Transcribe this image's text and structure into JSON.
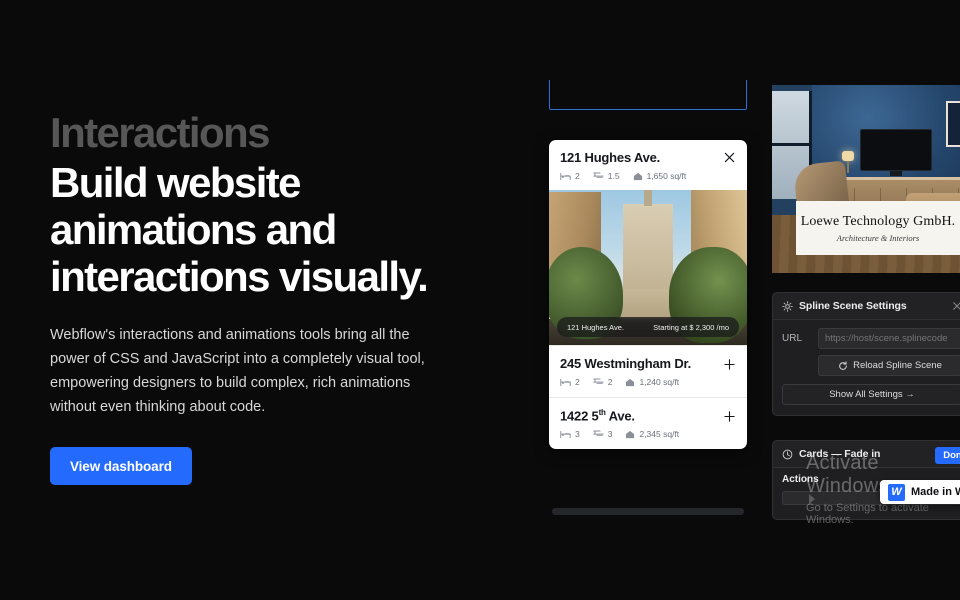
{
  "hero": {
    "eyebrow": "Interactions",
    "title_line1": "Build website",
    "title_line2": "animations and",
    "title_line3": "interactions visually.",
    "body": "Webflow's interactions and animations tools bring all the power of CSS and JavaScript into a completely visual tool, empowering designers to build complex, rich animations without even thinking about code.",
    "cta_label": "View dashboard",
    "accent_color": "#246bfd",
    "eyebrow_color": "#575757"
  },
  "property_card": {
    "header": {
      "title": "121 Hughes Ave.",
      "close_icon": "close-icon",
      "beds": "2",
      "baths": "1.5",
      "area": "1,650 sq/ft"
    },
    "photo_overlay": {
      "address": "121 Hughes Ave.",
      "price": "Starting at $ 2,300 /mo"
    },
    "listings": [
      {
        "title": "245 Westmingham Dr.",
        "beds": "2",
        "baths": "2",
        "area": "1,240 sq/ft",
        "action_icon": "plus-icon"
      },
      {
        "title": "1422 5",
        "title_sup": "th",
        "title_rest": " Ave.",
        "beds": "3",
        "baths": "3",
        "area": "2,345 sq/ft",
        "action_icon": "plus-icon"
      }
    ]
  },
  "showcase": {
    "plate_name": "Loewe Technology GmbH.",
    "plate_subtitle": "Architecture & Interiors"
  },
  "spline_panel": {
    "title": "Spline Scene Settings",
    "icon": "gear-icon",
    "close_icon": "close-icon",
    "url_label": "URL",
    "url_value": "https://host/scene.splinecode",
    "reload_label": "Reload Spline Scene",
    "reload_icon": "refresh-icon",
    "show_all_label": "Show All Settings  →"
  },
  "cards_panel": {
    "title": "Cards — Fade in",
    "icon": "clock-icon",
    "done_label": "Done",
    "actions_label": "Actions"
  },
  "watermark": {
    "title": "Activate Windows",
    "subtitle": "Go to Settings to activate Windows."
  },
  "made_in_webflow": {
    "label": "Made in Webflow",
    "logo": "webflow-logo"
  }
}
